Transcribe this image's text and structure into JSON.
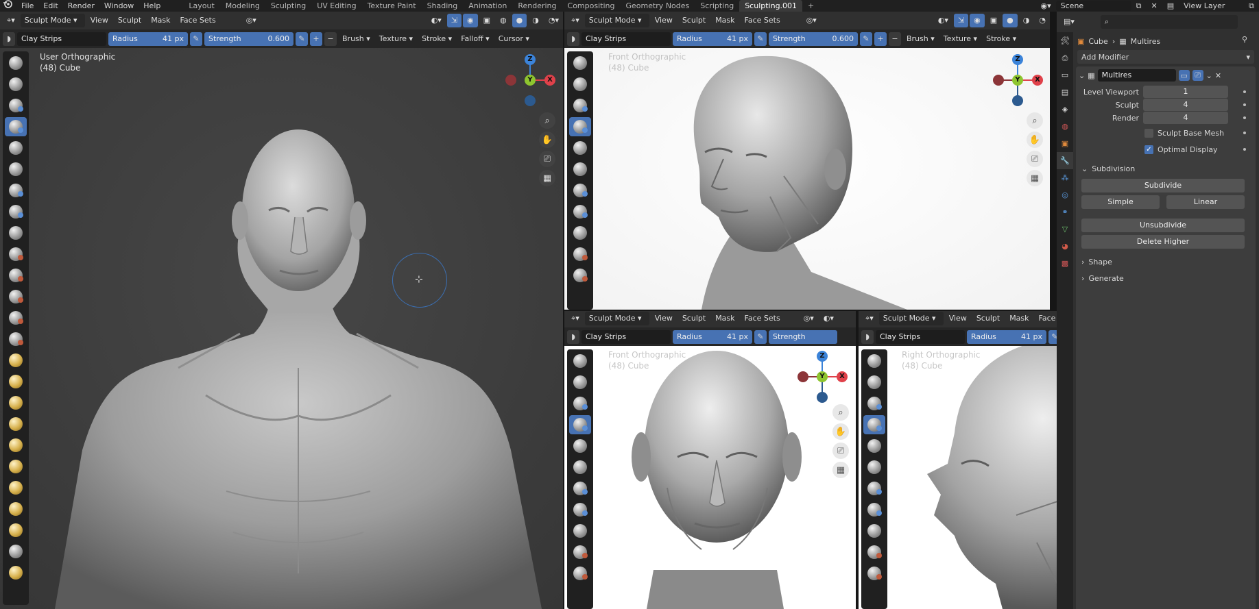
{
  "menu": [
    "File",
    "Edit",
    "Render",
    "Window",
    "Help"
  ],
  "workspaces": [
    "Layout",
    "Modeling",
    "Sculpting",
    "UV Editing",
    "Texture Paint",
    "Shading",
    "Animation",
    "Rendering",
    "Compositing",
    "Geometry Nodes",
    "Scripting",
    "Sculpting.001"
  ],
  "active_workspace_index": 11,
  "scene": "Scene",
  "view_layer": "View Layer",
  "header": {
    "mode": "Sculpt Mode",
    "menus": [
      "View",
      "Sculpt",
      "Mask",
      "Face Sets"
    ]
  },
  "tool": {
    "brush": "Clay Strips",
    "radius_label": "Radius",
    "radius_value": "41 px",
    "strength_label": "Strength",
    "strength_value": "0.600",
    "dropdowns": [
      "Brush",
      "Texture",
      "Stroke",
      "Falloff",
      "Cursor"
    ]
  },
  "viewports": {
    "main": {
      "view": "User Orthographic",
      "object": "(48) Cube"
    },
    "top_right": {
      "view": "Front Orthographic",
      "object": "(48) Cube"
    },
    "bottom_left": {
      "view": "Front Orthographic",
      "object": "(48) Cube"
    },
    "bottom_right": {
      "view": "Right Orthographic",
      "object": "(48) Cube"
    }
  },
  "gizmo": {
    "x": "X",
    "y": "Y",
    "z": "Z",
    "x_color": "#e0414a",
    "y_color": "#8ec52f",
    "z_color": "#3b83d9"
  },
  "properties": {
    "breadcrumb_object": "Cube",
    "breadcrumb_modifier": "Multires",
    "add_modifier": "Add Modifier",
    "modifier_name": "Multires",
    "level_viewport_label": "Level Viewport",
    "level_viewport": "1",
    "sculpt_label": "Sculpt",
    "sculpt": "4",
    "render_label": "Render",
    "render": "4",
    "sculpt_base_mesh": "Sculpt Base Mesh",
    "optimal_display": "Optimal Display",
    "subdivision": "Subdivision",
    "subdivide": "Subdivide",
    "simple": "Simple",
    "linear": "Linear",
    "unsubdivide": "Unsubdivide",
    "delete_higher": "Delete Higher",
    "shape": "Shape",
    "generate": "Generate"
  },
  "colors": {
    "accent": "#4772b3",
    "bg": "#2b2b2b",
    "header": "#303030"
  }
}
